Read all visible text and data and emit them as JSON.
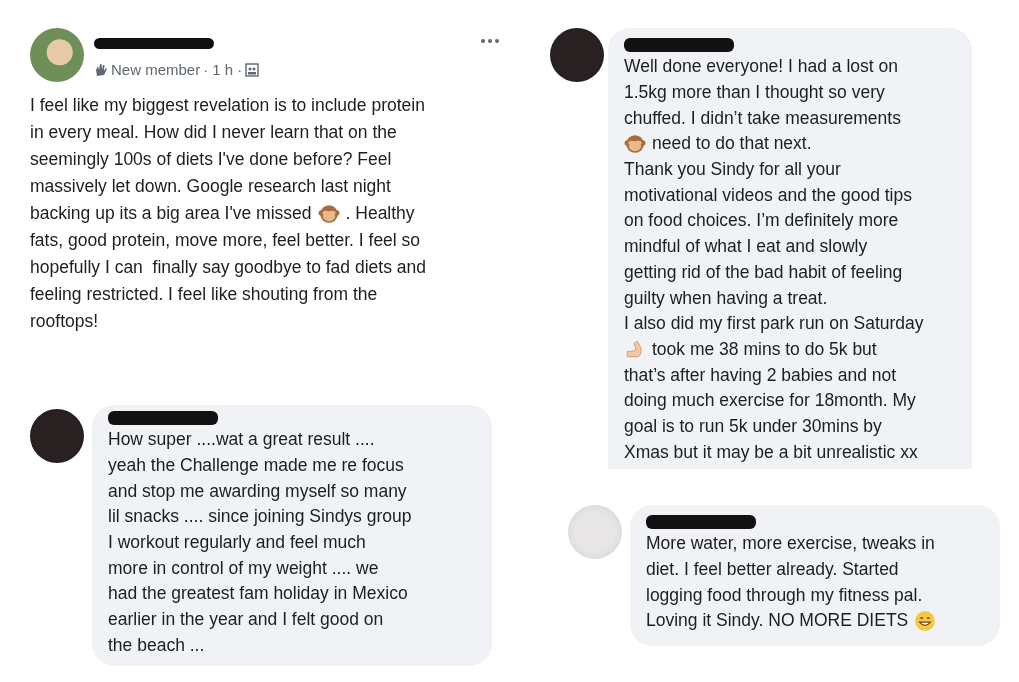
{
  "post": {
    "badge": "New member",
    "time": "· 1 h ·",
    "lines": [
      [
        {
          "kind": "text",
          "text": "I feel like my biggest revelation is to include protein"
        }
      ],
      [
        {
          "kind": "text",
          "text": "in every meal. How did I never learn that on the"
        }
      ],
      [
        {
          "kind": "text",
          "text": "seemingly 100s of diets I've done before? Feel"
        }
      ],
      [
        {
          "kind": "text",
          "text": "massively let down. Google research last night"
        }
      ],
      [
        {
          "kind": "text",
          "text": "backing up its a big area I've missed"
        },
        {
          "kind": "monkey"
        },
        {
          "kind": "text",
          "text": ". Healthy"
        }
      ],
      [
        {
          "kind": "text",
          "text": "fats, good protein, move more, feel better. I feel so"
        }
      ],
      [
        {
          "kind": "text",
          "text": "hopefully I can  finally say goodbye to fad diets and"
        }
      ],
      [
        {
          "kind": "text",
          "text": "feeling restricted. I feel like shouting from the"
        }
      ],
      [
        {
          "kind": "text",
          "text": "rooftops!"
        }
      ]
    ]
  },
  "right_comments": [
    {
      "lines": [
        [
          {
            "kind": "text",
            "text": "Well done everyone! I had a lost on"
          }
        ],
        [
          {
            "kind": "text",
            "text": "1.5kg more than I thought so very"
          }
        ],
        [
          {
            "kind": "text",
            "text": "chuffed. I didn’t take measurements"
          }
        ],
        [
          {
            "kind": "monkey"
          },
          {
            "kind": "text",
            "text": "need to do that next."
          }
        ],
        [
          {
            "kind": "text",
            "text": "Thank you Sindy for all your"
          }
        ],
        [
          {
            "kind": "text",
            "text": "motivational videos and the good tips"
          }
        ],
        [
          {
            "kind": "text",
            "text": "on food choices. I’m definitely more"
          }
        ],
        [
          {
            "kind": "text",
            "text": "mindful of what I eat and slowly"
          }
        ],
        [
          {
            "kind": "text",
            "text": "getting rid of the bad habit of feeling"
          }
        ],
        [
          {
            "kind": "text",
            "text": "guilty when having a treat."
          }
        ],
        [
          {
            "kind": "text",
            "text": "I also did my first park run on Saturday"
          }
        ],
        [
          {
            "kind": "flex"
          },
          {
            "kind": "text",
            "text": "took me 38 mins to do 5k but"
          }
        ],
        [
          {
            "kind": "text",
            "text": "that’s after having 2 babies and not"
          }
        ],
        [
          {
            "kind": "text",
            "text": "doing much exercise for 18month. My"
          }
        ],
        [
          {
            "kind": "text",
            "text": "goal is to run 5k under 30mins by"
          }
        ],
        [
          {
            "kind": "text",
            "text": "Xmas but it may be a bit unrealistic xx"
          }
        ]
      ]
    },
    {
      "lines": [
        [
          {
            "kind": "text",
            "text": "More water, more exercise, tweaks in"
          }
        ],
        [
          {
            "kind": "text",
            "text": "diet. I feel better already. Started"
          }
        ],
        [
          {
            "kind": "text",
            "text": "logging food through my fitness pal."
          }
        ],
        [
          {
            "kind": "text",
            "text": "Loving it Sindy. NO MORE DIETS"
          },
          {
            "kind": "grin"
          }
        ]
      ]
    }
  ],
  "left_comments": [
    {
      "lines": [
        [
          {
            "kind": "text",
            "text": "How super ....wat a great result ...."
          }
        ],
        [
          {
            "kind": "text",
            "text": "yeah the Challenge made me re focus"
          }
        ],
        [
          {
            "kind": "text",
            "text": "and stop me awarding myself so many"
          }
        ],
        [
          {
            "kind": "text",
            "text": "lil snacks .... since joining Sindys group"
          }
        ],
        [
          {
            "kind": "text",
            "text": "I workout regularly and feel much"
          }
        ],
        [
          {
            "kind": "text",
            "text": "more in control of my weight .... we"
          }
        ],
        [
          {
            "kind": "text",
            "text": "had the greatest fam holiday in Mexico"
          }
        ],
        [
          {
            "kind": "text",
            "text": "earlier in the year and I felt good on"
          }
        ],
        [
          {
            "kind": "text",
            "text": "the beach ..."
          }
        ]
      ]
    }
  ]
}
